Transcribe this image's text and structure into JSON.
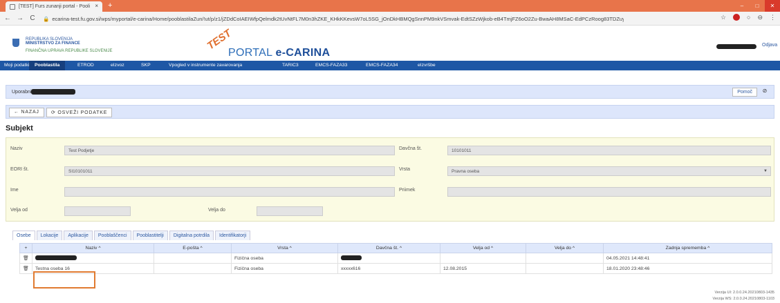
{
  "browser": {
    "tab_title": "[TEST] Furs zunanji portal - Pooli",
    "tab_close": "×",
    "new_tab": "+",
    "url": "ecarina-test.fu.gov.si/wps/myportal/e-carina/Home/pooblastilaZun/!ut/p/z1/jZDdCoIAEIWfpQelmdk2tUvNtFL7M0n3hZKE_KHkKKevsW7oL5SG_jOnDkHBMQgSnnPM9nkVSmvak-EdtSZzWjkob-eB4TmjFZ6oO2Zu-BwaAH8MSaC-EdPCzRoog83TDZuydmRwz1...",
    "minimize": "–",
    "maximize": "□",
    "close": "✕"
  },
  "header": {
    "country": "REPUBLIKA SLOVENIJA",
    "ministry": "MINISTRSTVO ZA FINANCE",
    "authority": "FINANČNA UPRAVA REPUBLIKE SLOVENIJE",
    "test_badge": "TEST",
    "portal_prefix": "PORTAL ",
    "portal_name": "e-CARINA",
    "logout": "Odjava"
  },
  "menu": [
    "Moji podatki",
    "Pooblastila",
    "ETROD",
    "eIzvoz",
    "SKP",
    "Vpogled v instrumente zavarovanja",
    "TARIC3",
    "EMCS-FAZA33",
    "EMCS-FAZA34",
    "eIzvršbe"
  ],
  "userbar": {
    "label": "Uporabnik:",
    "help": "Pomoč",
    "help_icon": "⊘"
  },
  "buttons": {
    "back": "NAZAJ",
    "refresh": "OSVEŽI PODATKE"
  },
  "subject_title": "Subjekt",
  "form": {
    "naziv_label": "Naziv",
    "naziv_value": "Test Podjetje",
    "davcna_label": "Davčna št.",
    "davcna_value": "10101011",
    "eori_label": "EORI št.",
    "eori_value": "SI10101011",
    "vrsta_label": "Vrsta",
    "vrsta_value": "Pravna oseba",
    "ime_label": "Ime",
    "ime_value": "",
    "priimek_label": "Priimek",
    "priimek_value": "",
    "velja_od_label": "Velja od",
    "velja_od_value": "",
    "velja_do_label": "Velja do",
    "velja_do_value": ""
  },
  "tabs": [
    "Osebe",
    "Lokacije",
    "Aplikacije",
    "Pooblaščenci",
    "Pooblastitelji",
    "Digitalna potrdila",
    "Identifikatorji"
  ],
  "table": {
    "add": "+",
    "headers": [
      "Naziv ^",
      "E-pošta ^",
      "Vrsta ^",
      "Davčna št. ^",
      "Velja od ^",
      "Velja do ^",
      "Zadnja sprememba ^"
    ],
    "rows": [
      {
        "naziv": "",
        "eposta": "",
        "vrsta": "Fizična oseba",
        "davcna": "",
        "velja_od": "",
        "velja_do": "",
        "zadnja": "04.05.2021 14:48:41"
      },
      {
        "naziv": "Testna oseba 16",
        "eposta": "",
        "vrsta": "Fizična oseba",
        "davcna": "xxxxx616",
        "velja_od": "12.08.2015",
        "velja_do": "",
        "zadnja": "18.01.2020 23:48:46"
      }
    ]
  },
  "version": {
    "ui": "Verzija UI: 2.0.0.24.20210803-1435",
    "ws": "Verzija WS: 2.0.0.24.20210803-1103"
  }
}
